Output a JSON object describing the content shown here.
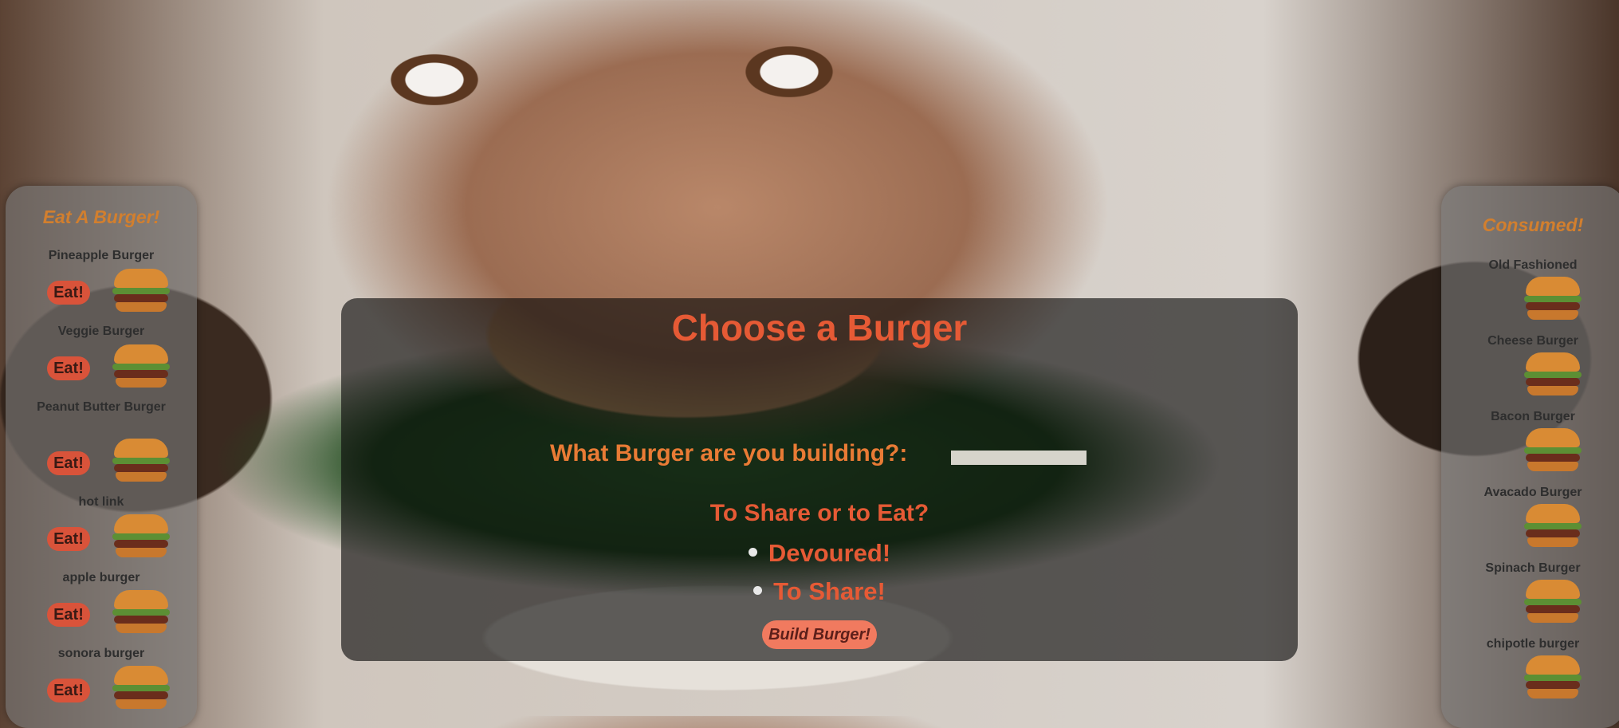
{
  "left_sidebar": {
    "title": "Eat A Burger!",
    "button_label": "Eat!",
    "items": [
      {
        "name": "Pineapple Burger"
      },
      {
        "name": "Veggie Burger"
      },
      {
        "name": "Peanut Butter Burger"
      },
      {
        "name": "hot link"
      },
      {
        "name": "apple burger"
      },
      {
        "name": "sonora burger"
      }
    ]
  },
  "main": {
    "title": "Choose a Burger",
    "input_label": "What Burger are you building?:",
    "input_value": "",
    "share_question": "To Share or to Eat?",
    "options": [
      "Devoured!",
      "To Share!"
    ],
    "submit_label": "Build Burger!"
  },
  "right_sidebar": {
    "title": "Consumed!",
    "items": [
      {
        "name": "Old Fashioned"
      },
      {
        "name": "Cheese Burger"
      },
      {
        "name": "Bacon Burger"
      },
      {
        "name": "Avacado Burger"
      },
      {
        "name": "Spinach Burger"
      },
      {
        "name": "chipotle burger"
      }
    ]
  },
  "colors": {
    "accent": "#e65a35",
    "sidebar_title": "#d27f2e",
    "eat_button": "#d9533a",
    "build_button": "#f17a5f"
  }
}
